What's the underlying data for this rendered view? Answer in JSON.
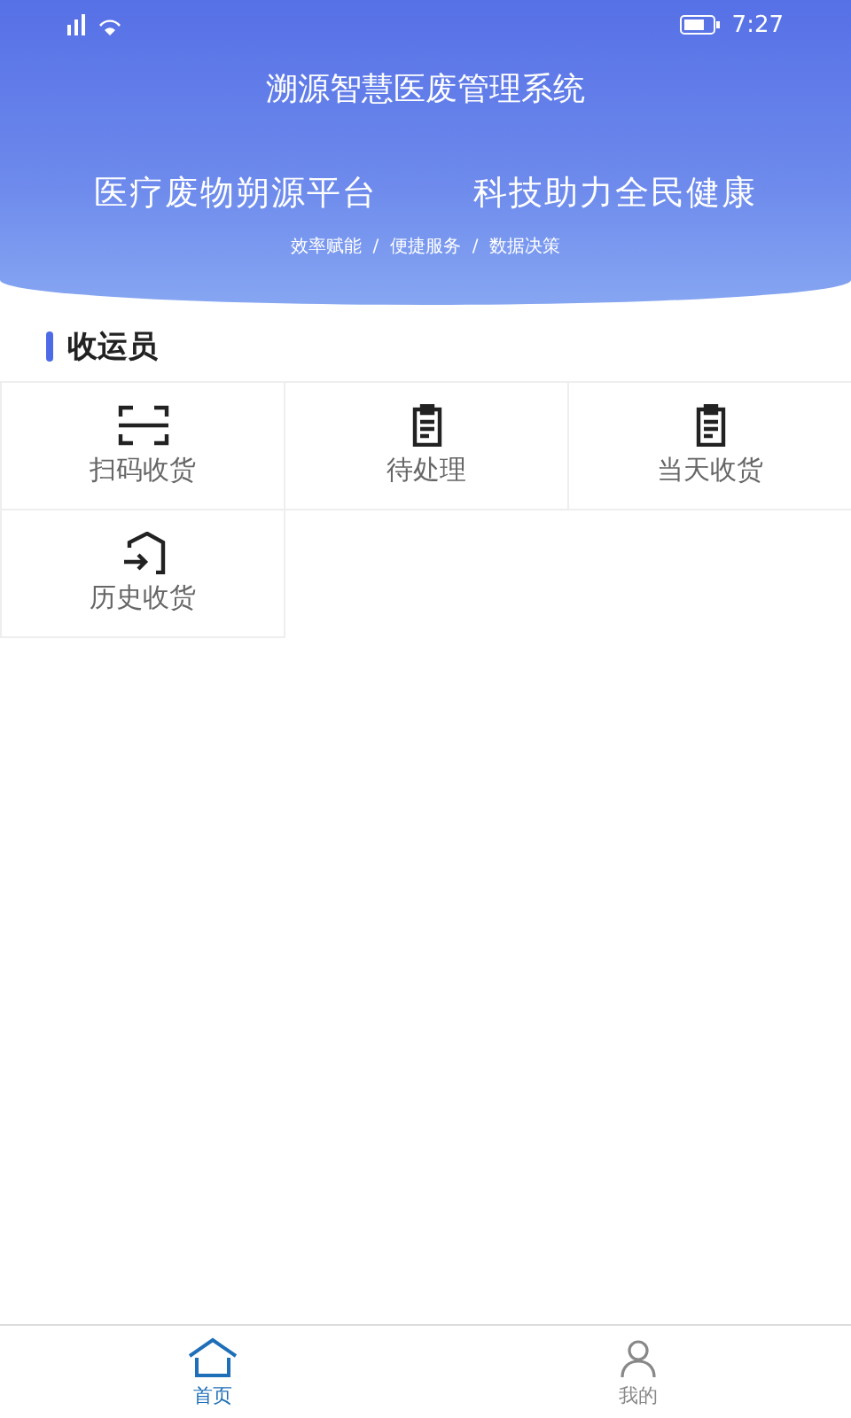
{
  "status_bar": {
    "time": "7:27"
  },
  "header": {
    "title": "溯源智慧医废管理系统",
    "slogan_left": "医疗废物朔源平台",
    "slogan_right": "科技助力全民健康",
    "tagline": "效率赋能  /  便捷服务  /  数据决策"
  },
  "section": {
    "title": "收运员"
  },
  "tiles": [
    {
      "kind": "scan",
      "label": "扫码收货"
    },
    {
      "kind": "clipboard",
      "label": "待处理"
    },
    {
      "kind": "clipboard",
      "label": "当天收货"
    },
    {
      "kind": "history",
      "label": "历史收货"
    }
  ],
  "tab_bar": [
    {
      "kind": "home",
      "label": "首页",
      "selected": true
    },
    {
      "kind": "user",
      "label": "我的",
      "selected": false
    }
  ]
}
